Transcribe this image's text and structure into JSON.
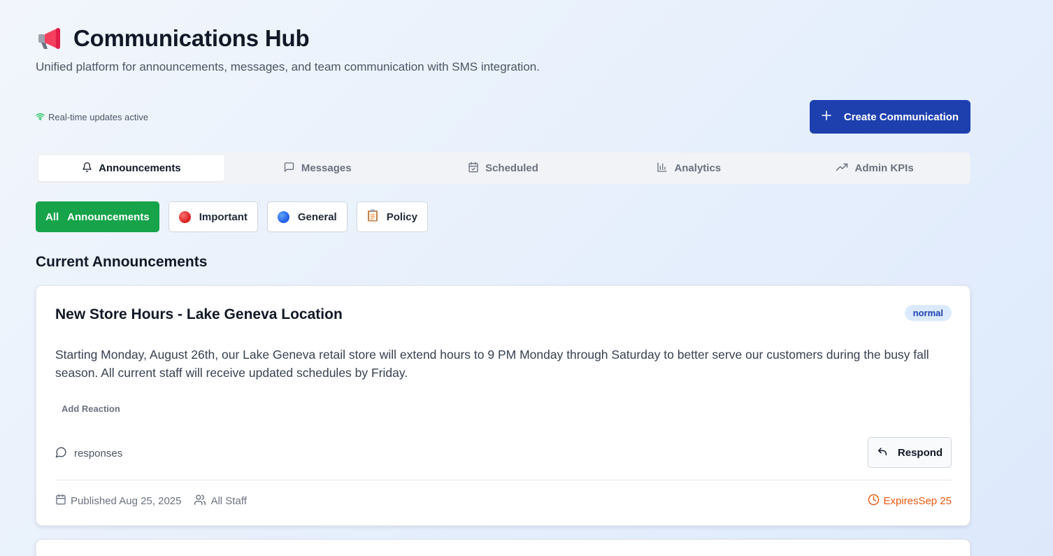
{
  "header": {
    "title": "Communications Hub",
    "subtitle": "Unified platform for announcements, messages, and team communication with SMS integration.",
    "title_icon": "megaphone-icon"
  },
  "status": {
    "text": "Real-time updates active",
    "icon": "wifi-icon",
    "color": "#22c55e"
  },
  "actions": {
    "create_label": "Create Communication",
    "create_icon": "plus-icon",
    "accent": "#1e40af"
  },
  "tabs": [
    {
      "label": "Announcements",
      "icon": "bell-icon",
      "active": true
    },
    {
      "label": "Messages",
      "icon": "message-icon",
      "active": false
    },
    {
      "label": "Scheduled",
      "icon": "calendar-check-icon",
      "active": false
    },
    {
      "label": "Analytics",
      "icon": "bar-chart-icon",
      "active": false
    },
    {
      "label": "Admin KPIs",
      "icon": "trending-up-icon",
      "active": false
    }
  ],
  "filters": [
    {
      "label_prefix": "All",
      "label": "Announcements",
      "active": true,
      "color": "#16a34a"
    },
    {
      "label": "Important",
      "icon": "red-circle-icon"
    },
    {
      "label": "General",
      "icon": "blue-circle-icon"
    },
    {
      "label": "Policy",
      "icon": "clipboard-icon"
    }
  ],
  "section_title": "Current Announcements",
  "announcements": [
    {
      "title": "New Store Hours - Lake Geneva Location",
      "priority": "normal",
      "body": "Starting Monday, August 26th, our Lake Geneva retail store will extend hours to 9 PM Monday through Saturday to better serve our customers during the busy fall season. All current staff will receive updated schedules by Friday.",
      "reaction_label": "Add Reaction",
      "responses_label": "responses",
      "respond_label": "Respond",
      "published": "Published Aug 25, 2025",
      "audience": "All Staff",
      "expires": "ExpiresSep 25",
      "expires_color": "#ea580c"
    }
  ]
}
